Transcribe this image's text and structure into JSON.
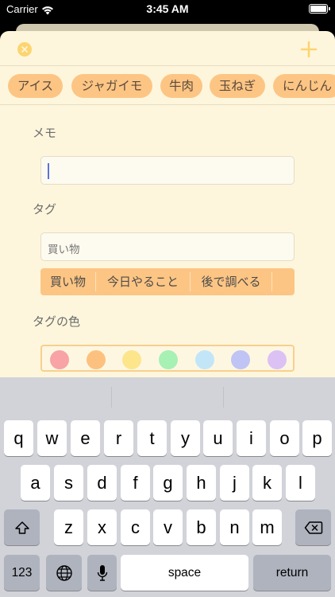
{
  "status_bar": {
    "carrier": "Carrier",
    "time": "3:45 AM"
  },
  "nav": {
    "accent_color": "#fcd571"
  },
  "tag_chips": [
    "アイス",
    "ジャガイモ",
    "牛肉",
    "玉ねぎ",
    "にんじん"
  ],
  "memo": {
    "label": "メモ",
    "value": ""
  },
  "tag": {
    "label": "タグ",
    "value": "買い物",
    "segments": [
      "買い物",
      "今日やること",
      "後で調べる"
    ]
  },
  "tag_color": {
    "label": "タグの色",
    "colors": [
      "#f8a3a6",
      "#fdc17f",
      "#fde58c",
      "#a6f1b3",
      "#c2e6f7",
      "#bfc4f4",
      "#dbc1f4"
    ]
  },
  "keyboard": {
    "row1": [
      "q",
      "w",
      "e",
      "r",
      "t",
      "y",
      "u",
      "i",
      "o",
      "p"
    ],
    "row2": [
      "a",
      "s",
      "d",
      "f",
      "g",
      "h",
      "j",
      "k",
      "l"
    ],
    "row3": [
      "z",
      "x",
      "c",
      "v",
      "b",
      "n",
      "m"
    ],
    "numbers_label": "123",
    "space_label": "space",
    "return_label": "return"
  }
}
